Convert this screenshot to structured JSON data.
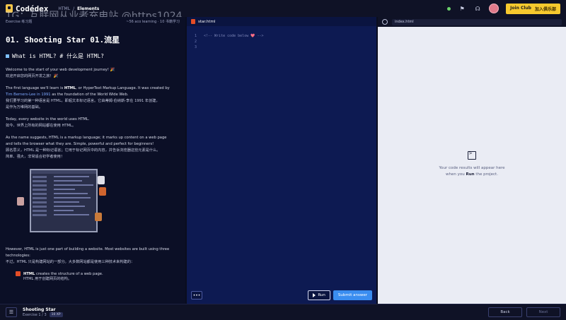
{
  "topbar": {
    "logo": "Codédex",
    "crumbs": [
      "HTML",
      "/",
      "Elements"
    ],
    "watermark": "TG：互联网从业者充电站 @https1024",
    "join_label": "Join Club",
    "join_label_cn": "加入俱乐部"
  },
  "left": {
    "exercise_label": "Exercise 练习题",
    "learning_text": "~56 aco learning · 10 书籍学习",
    "title": "01. Shooting Star  01.流星",
    "subtitle": "What is HTML?  # 什么是 HTML?",
    "p1_en": "Welcome to the start of your web development journey! 🎉",
    "p1_cn": "欢迎开启您的网页开发之旅！🎉",
    "p2_en_a": "The first language we'll learn is ",
    "p2_en_b": "HTML",
    "p2_en_c": ", or HyperText Markup Language. It was created by",
    "p2_en_d": "Tim Berners-Lee in 1991",
    "p2_en_e": " as the foundation of the World Wide Web.",
    "p2_cn_1": "我们要学习的第一种语言是 HTML，即超文本标记语言。它由蒂姆·伯纳斯-李在 1991 年创建，",
    "p2_cn_2": "是作为万维网的基础。",
    "p3_en": "Today, every website in the world uses HTML.",
    "p3_cn": "如今，世界上所有的网站都在使用 HTML。",
    "p4_en_1": "As the name suggests, HTML is a markup language; it marks up content on a web page",
    "p4_en_2": "and tells the browser what they are. Simple, powerful and perfect for beginners!",
    "p4_cn_1": "顾名思义，HTML 是一种标记语言；它用于标记网页中的内容，并告诉浏览器这些元素是什么。",
    "p4_cn_2": "简单、强大，非常适合初学者使用！",
    "p5_en_1": "However, HTML is just one part of building a website. Most websites are built using three",
    "p5_en_2": "technologies:",
    "p5_cn": "不过，HTML 只是构建网站的一部分。大多数网站都是使用三种技术来构建的：",
    "bullet_en_a": "HTML",
    "bullet_en_b": " creates the structure of a web page.",
    "bullet_cn": "HTML 用于创建网页的结构。"
  },
  "editor": {
    "file_name": "star.html",
    "lines": [
      {
        "n": "1",
        "text": "<!-- Write code below ",
        "heart": "💖",
        "end": " -->"
      },
      {
        "n": "2",
        "text": "",
        "heart": "",
        "end": ""
      },
      {
        "n": "3",
        "text": "",
        "heart": "",
        "end": ""
      }
    ],
    "more_label": "•••",
    "run_label": "Run",
    "submit_label": "Submit answer"
  },
  "preview": {
    "url": "index.html",
    "empty_1": "Your code results will appear here",
    "empty_2a": "when you ",
    "empty_2b": "Run",
    "empty_2c": " the project."
  },
  "bottombar": {
    "title": "Shooting Star",
    "sub": "Exercise 1 / 3",
    "xp": "10 XP",
    "back_label": "Back",
    "next_label": "Next"
  }
}
